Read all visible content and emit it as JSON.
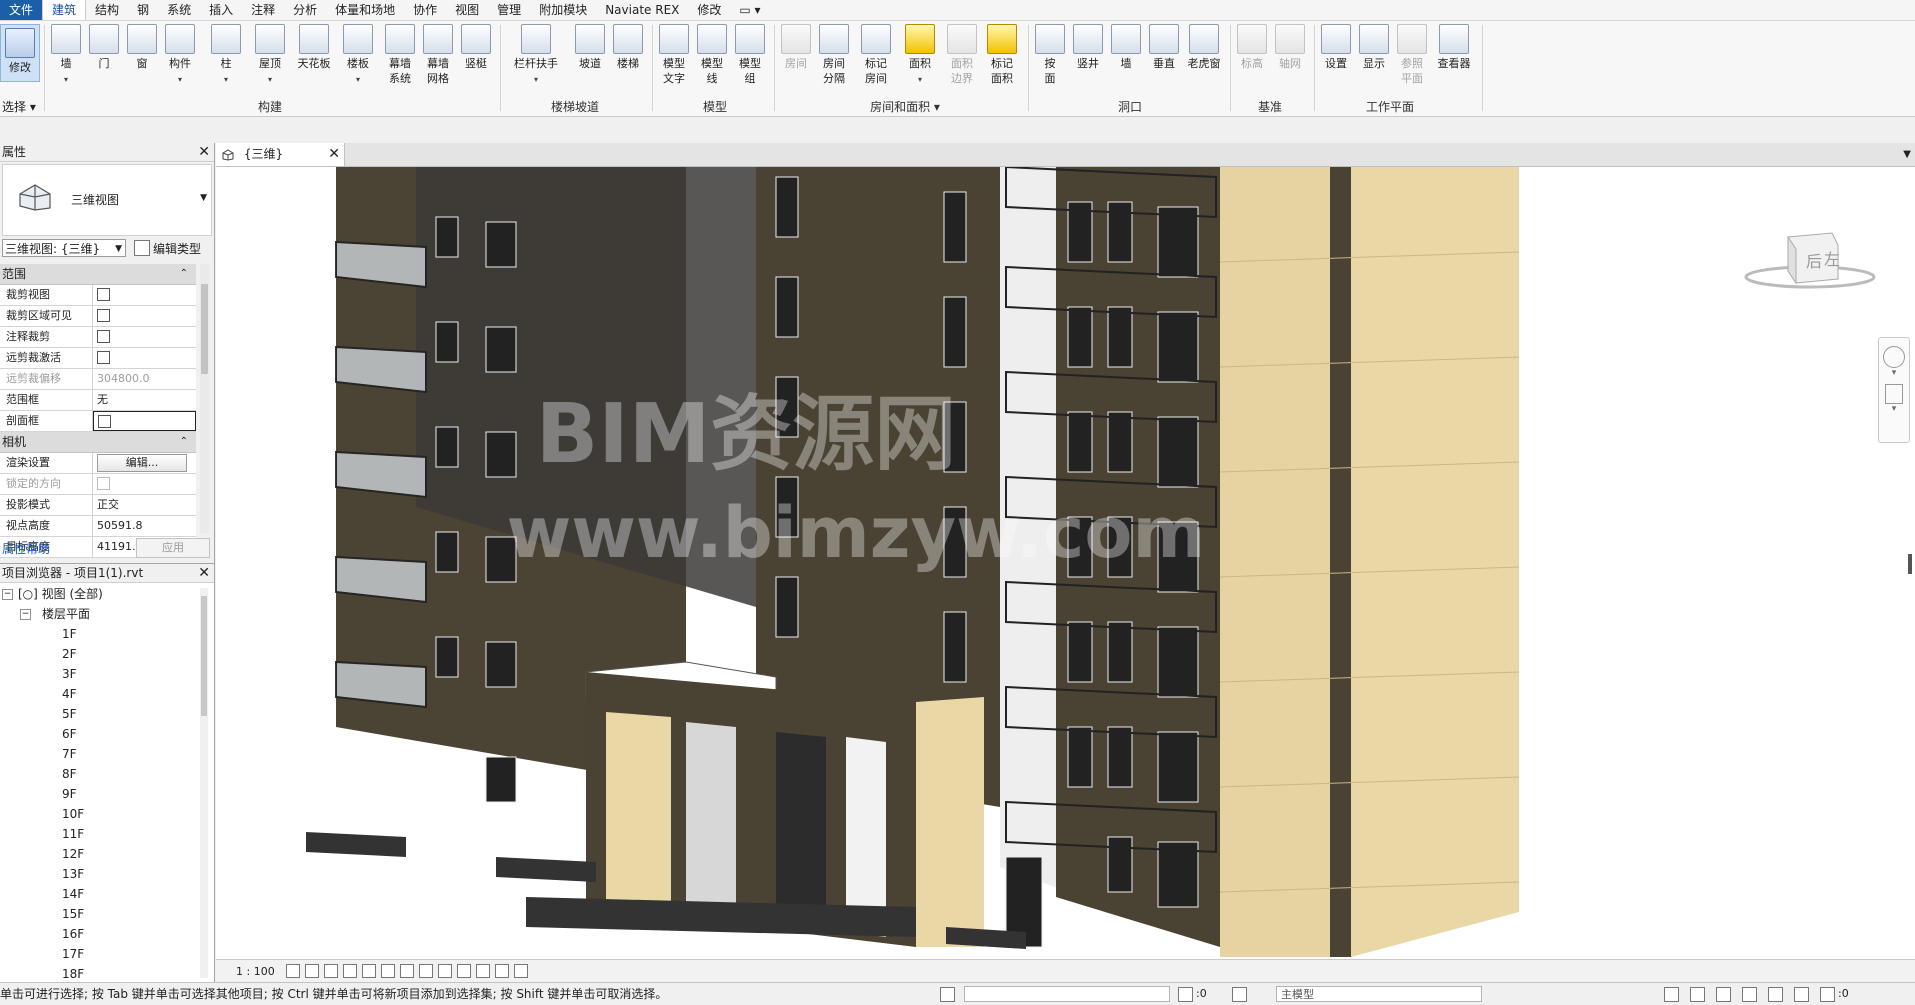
{
  "menu": {
    "items": [
      "文件",
      "建筑",
      "结构",
      "钢",
      "系统",
      "插入",
      "注释",
      "分析",
      "体量和场地",
      "协作",
      "视图",
      "管理",
      "附加模块",
      "Naviate REX",
      "修改",
      "▭ ▾"
    ],
    "active_index": 1
  },
  "ribbon": {
    "modify": {
      "label": "修改",
      "footer": "选择 ▾"
    },
    "groups": [
      {
        "label": "构建"
      },
      {
        "label": "楼梯坡道"
      },
      {
        "label": "模型"
      },
      {
        "label": "房间和面积 ▾"
      },
      {
        "label": "洞口"
      },
      {
        "label": "基准"
      },
      {
        "label": "工作平面"
      }
    ],
    "buttons": [
      {
        "label": "墙",
        "sub": "▾"
      },
      {
        "label": "门",
        "sub": ""
      },
      {
        "label": "窗",
        "sub": ""
      },
      {
        "label": "构件",
        "sub": "▾"
      },
      {
        "label": "柱",
        "sub": "▾"
      },
      {
        "label": "屋顶",
        "sub": "▾"
      },
      {
        "label": "天花板",
        "sub": ""
      },
      {
        "label": "楼板",
        "sub": "▾"
      },
      {
        "label": "幕墙",
        "sub": "系统"
      },
      {
        "label": "幕墙",
        "sub": "网格"
      },
      {
        "label": "竖梃",
        "sub": ""
      },
      {
        "label": "栏杆扶手",
        "sub": "▾"
      },
      {
        "label": "坡道",
        "sub": ""
      },
      {
        "label": "楼梯",
        "sub": ""
      },
      {
        "label": "模型",
        "sub": "文字"
      },
      {
        "label": "模型",
        "sub": "线"
      },
      {
        "label": "模型",
        "sub": "组"
      },
      {
        "label": "房间",
        "sub": ""
      },
      {
        "label": "房间",
        "sub": "分隔"
      },
      {
        "label": "标记",
        "sub": "房间"
      },
      {
        "label": "面积",
        "sub": "▾"
      },
      {
        "label": "面积",
        "sub": "边界"
      },
      {
        "label": "标记",
        "sub": "面积"
      },
      {
        "label": "按",
        "sub": "面"
      },
      {
        "label": "竖井",
        "sub": ""
      },
      {
        "label": "墙",
        "sub": ""
      },
      {
        "label": "垂直",
        "sub": ""
      },
      {
        "label": "老虎窗",
        "sub": ""
      },
      {
        "label": "标高",
        "sub": ""
      },
      {
        "label": "轴网",
        "sub": ""
      },
      {
        "label": "设置",
        "sub": ""
      },
      {
        "label": "显示",
        "sub": ""
      },
      {
        "label": "参照",
        "sub": "平面"
      },
      {
        "label": "查看器",
        "sub": ""
      }
    ]
  },
  "properties": {
    "title": "属性",
    "type_name": "三维视图",
    "view_selector": "三维视图: {三维}",
    "edit_type": "编辑类型",
    "sections": [
      {
        "name": "范围",
        "rows": [
          {
            "key": "裁剪视图",
            "value": "",
            "checkbox": true
          },
          {
            "key": "裁剪区域可见",
            "value": "",
            "checkbox": true
          },
          {
            "key": "注释裁剪",
            "value": "",
            "checkbox": true
          },
          {
            "key": "远剪裁激活",
            "value": "",
            "checkbox": true
          },
          {
            "key": "远剪裁偏移",
            "value": "304800.0",
            "checkbox": false,
            "disabled": true
          },
          {
            "key": "范围框",
            "value": "无",
            "checkbox": false
          },
          {
            "key": "剖面框",
            "value": "",
            "checkbox": true
          }
        ]
      },
      {
        "name": "相机",
        "rows": [
          {
            "key": "渲染设置",
            "value": "编辑...",
            "button": true
          },
          {
            "key": "锁定的方向",
            "value": "",
            "checkbox": true,
            "disabled": true
          },
          {
            "key": "投影模式",
            "value": "正交"
          },
          {
            "key": "视点高度",
            "value": "50591.8"
          },
          {
            "key": "目标高度",
            "value": "41191.9"
          }
        ]
      }
    ],
    "help": "属性帮助",
    "apply": "应用"
  },
  "project_browser": {
    "title": "项目浏览器 - 项目1(1).rvt",
    "root": "[○] 视图 (全部)",
    "group": "楼层平面",
    "levels": [
      "1F",
      "2F",
      "3F",
      "4F",
      "5F",
      "6F",
      "7F",
      "8F",
      "9F",
      "10F",
      "11F",
      "12F",
      "13F",
      "14F",
      "15F",
      "16F",
      "17F",
      "18F"
    ]
  },
  "view": {
    "tab_title": "{三维}",
    "scale": "1 : 100",
    "cube_labels": {
      "front": "后",
      "side": "左"
    },
    "watermark_line1": "BIM资源网",
    "watermark_line2": "www.bimzyw.com"
  },
  "statusbar": {
    "text": "单击可进行选择; 按 Tab 键并单击可选择其他项目; 按 Ctrl 键并单击可将新项目添加到选择集; 按 Shift 键并单击可取消选择。",
    "zero1": ":0",
    "model": "主模型",
    "filter": ":0"
  },
  "colors": {
    "file_menu": "#1a5fa8",
    "dark_facade": "#4a4232",
    "light_facade": "#e9d7a6",
    "modify_highlight": "#cfe1f7"
  }
}
